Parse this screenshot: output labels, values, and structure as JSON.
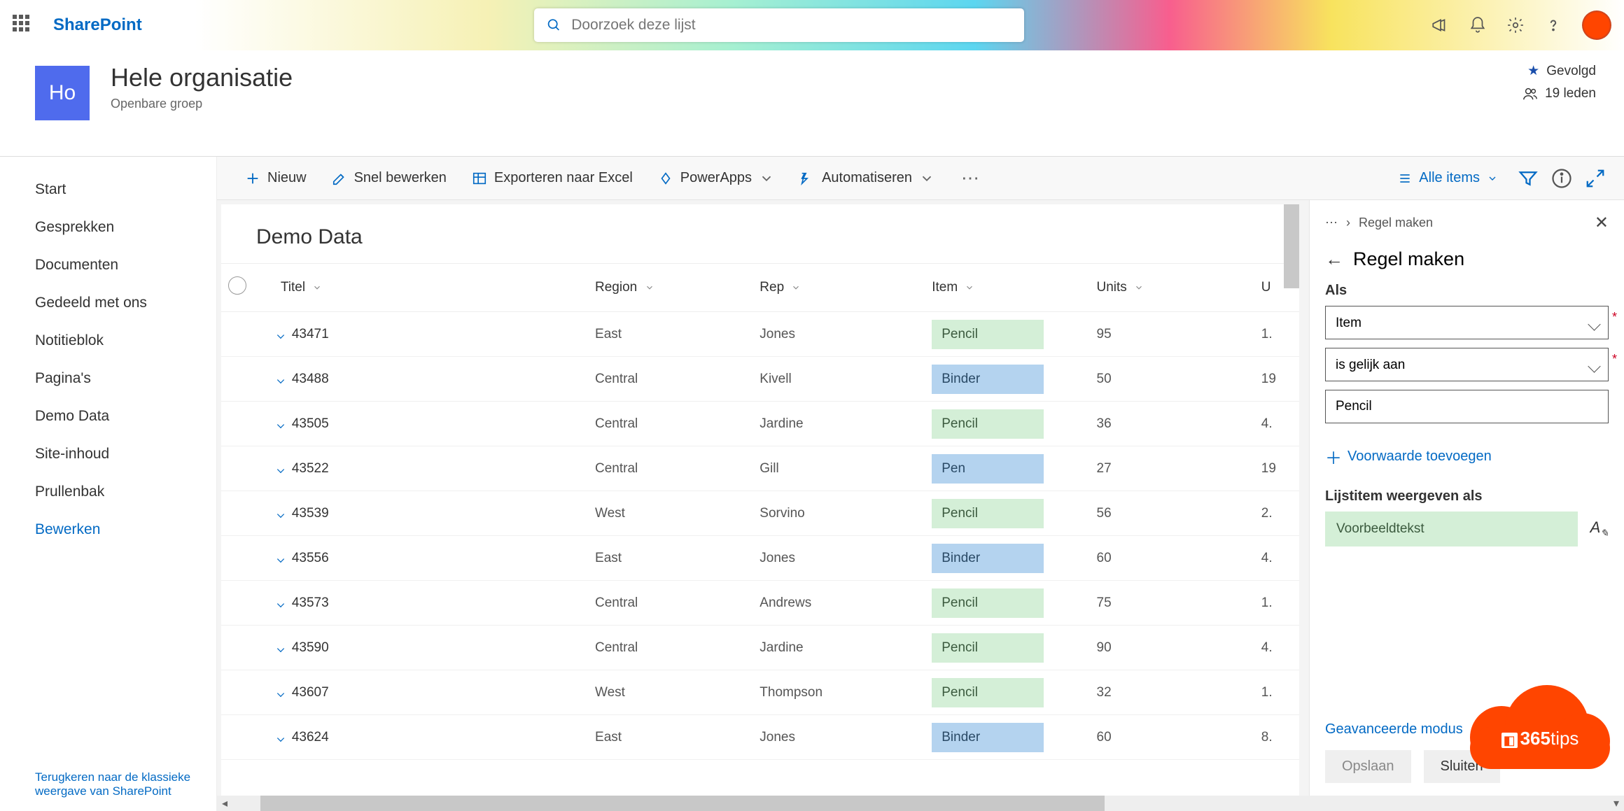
{
  "brand": "SharePoint",
  "search": {
    "placeholder": "Doorzoek deze lijst"
  },
  "site": {
    "logo_text": "Ho",
    "title": "Hele organisatie",
    "subtitle": "Openbare groep",
    "followed_label": "Gevolgd",
    "members_label": "19 leden"
  },
  "nav": {
    "items": [
      "Start",
      "Gesprekken",
      "Documenten",
      "Gedeeld met ons",
      "Notitieblok",
      "Pagina's",
      "Demo Data",
      "Site-inhoud",
      "Prullenbak"
    ],
    "edit": "Bewerken",
    "classic": "Terugkeren naar de klassieke weergave van SharePoint"
  },
  "cmdbar": {
    "new_": "Nieuw",
    "quickedit": "Snel bewerken",
    "export": "Exporteren naar Excel",
    "powerapps": "PowerApps",
    "automate": "Automatiseren",
    "view": "Alle items"
  },
  "list": {
    "title": "Demo Data",
    "columns": {
      "titel": "Titel",
      "region": "Region",
      "rep": "Rep",
      "item": "Item",
      "units": "Units",
      "u": "U"
    },
    "rows": [
      {
        "titel": "43471",
        "region": "East",
        "rep": "Jones",
        "item": "Pencil",
        "item_style": "green",
        "units": "95",
        "u": "1."
      },
      {
        "titel": "43488",
        "region": "Central",
        "rep": "Kivell",
        "item": "Binder",
        "item_style": "blue",
        "units": "50",
        "u": "19"
      },
      {
        "titel": "43505",
        "region": "Central",
        "rep": "Jardine",
        "item": "Pencil",
        "item_style": "green",
        "units": "36",
        "u": "4."
      },
      {
        "titel": "43522",
        "region": "Central",
        "rep": "Gill",
        "item": "Pen",
        "item_style": "blue",
        "units": "27",
        "u": "19"
      },
      {
        "titel": "43539",
        "region": "West",
        "rep": "Sorvino",
        "item": "Pencil",
        "item_style": "green",
        "units": "56",
        "u": "2."
      },
      {
        "titel": "43556",
        "region": "East",
        "rep": "Jones",
        "item": "Binder",
        "item_style": "blue",
        "units": "60",
        "u": "4."
      },
      {
        "titel": "43573",
        "region": "Central",
        "rep": "Andrews",
        "item": "Pencil",
        "item_style": "green",
        "units": "75",
        "u": "1."
      },
      {
        "titel": "43590",
        "region": "Central",
        "rep": "Jardine",
        "item": "Pencil",
        "item_style": "green",
        "units": "90",
        "u": "4."
      },
      {
        "titel": "43607",
        "region": "West",
        "rep": "Thompson",
        "item": "Pencil",
        "item_style": "green",
        "units": "32",
        "u": "1."
      },
      {
        "titel": "43624",
        "region": "East",
        "rep": "Jones",
        "item": "Binder",
        "item_style": "blue",
        "units": "60",
        "u": "8."
      }
    ]
  },
  "panel": {
    "breadcrumb": "Regel maken",
    "title": "Regel maken",
    "section1_label": "Als",
    "field_column": "Item",
    "field_operator": "is gelijk aan",
    "field_value": "Pencil",
    "add_condition": "Voorwaarde toevoegen",
    "section2_label": "Lijstitem weergeven als",
    "sample_text": "Voorbeeldtekst",
    "advanced": "Geavanceerde modus",
    "save": "Opslaan",
    "close": "Sluiten"
  },
  "watermark": "365tips"
}
